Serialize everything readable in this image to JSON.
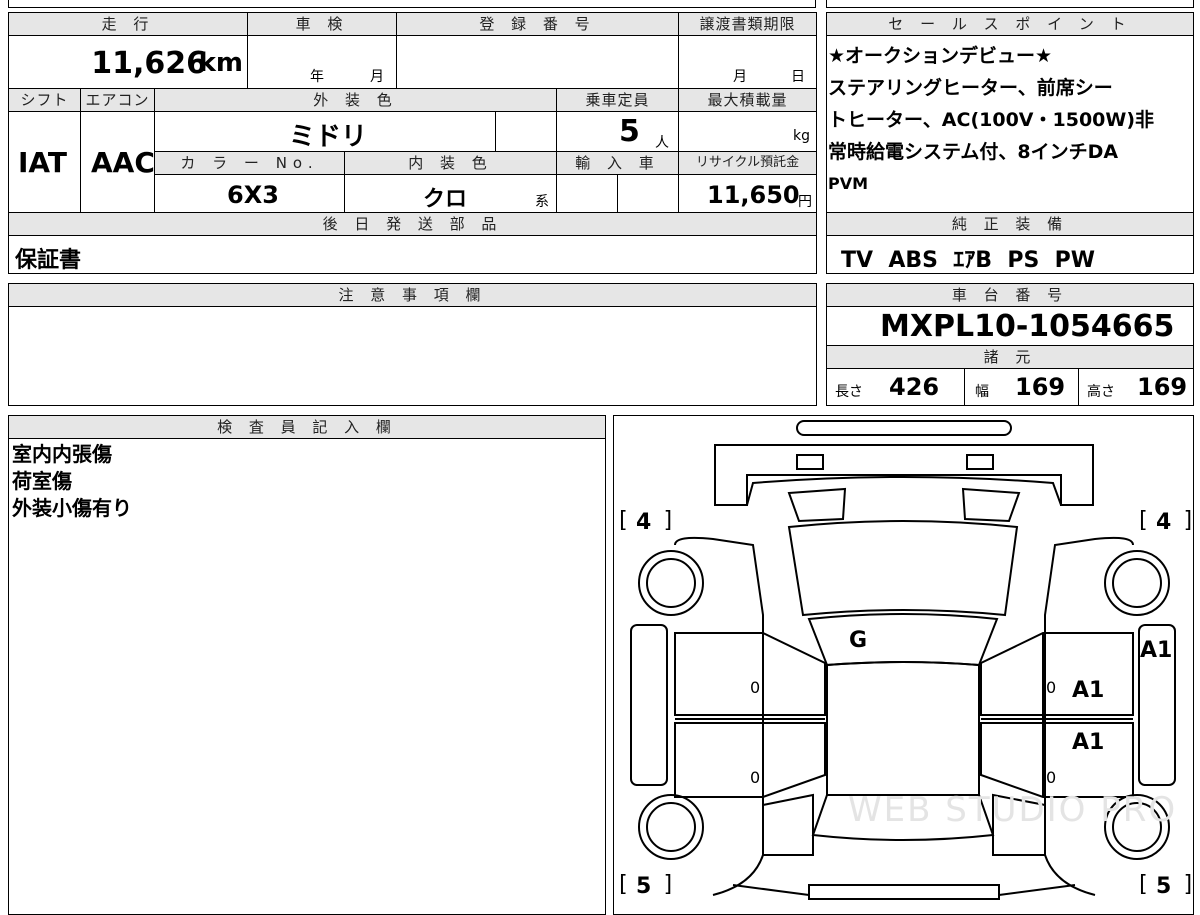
{
  "mileage": {
    "header": "走 行",
    "value": "11,626",
    "unit": "km"
  },
  "inspection": {
    "header": "車 検",
    "year_label": "年",
    "month_label": "月"
  },
  "registration": {
    "header": "登 録 番 号",
    "value": ""
  },
  "transfer_deadline": {
    "header": "譲渡書類期限",
    "month_label": "月",
    "day_label": "日"
  },
  "shift": {
    "header": "シフト",
    "value": "IAT"
  },
  "aircon": {
    "header": "エアコン",
    "value": "AAC"
  },
  "exterior_color": {
    "header": "外 装 色",
    "value": "ミドリ"
  },
  "capacity": {
    "header": "乗車定員",
    "value": "5",
    "unit": "人"
  },
  "max_load": {
    "header": "最大積載量",
    "unit": "kg"
  },
  "color_no": {
    "header": "カ ラ ー No.",
    "value": "6X3"
  },
  "interior_color": {
    "header": "内 装 色",
    "value": "クロ",
    "suffix": "系"
  },
  "import": {
    "header": "輸 入 車"
  },
  "recycle": {
    "header": "リサイクル預託金",
    "value": "11,650",
    "unit": "円"
  },
  "later_parts": {
    "header": "後 日 発 送 部 品",
    "value": "保証書"
  },
  "sales_points": {
    "header": "セ ー ル ス ポ イ ン ト",
    "lines": [
      "★オークションデビュー★",
      "ステアリングヒーター、前席シー",
      "トヒーター、AC(100V・1500W)非",
      "常時給電システム付、8インチDA",
      "PVM"
    ]
  },
  "equipment": {
    "header": "純 正 装 備",
    "value": "TV  ABS  ｴｱB  PS  PW"
  },
  "notes": {
    "header": "注 意 事 項 欄"
  },
  "chassis": {
    "header": "車 台 番 号",
    "value": "MXPL10-1054665"
  },
  "dims": {
    "header": "諸 元",
    "length_label": "長さ",
    "length": "426",
    "width_label": "幅",
    "width": "169",
    "height_label": "高さ",
    "height": "169"
  },
  "inspector": {
    "header": "検 査 員 記 入 欄",
    "lines": [
      "室内内張傷",
      "荷室傷",
      "外装小傷有り"
    ]
  },
  "diagram": {
    "tire_front_left": "4",
    "tire_front_right": "4",
    "tire_rear_left": "5",
    "tire_rear_right": "5",
    "windshield": "G",
    "right_fender": "A1",
    "right_front_door": "A1",
    "right_rear_door": "A1",
    "door_mark_lf": "0",
    "door_mark_lr": "0",
    "door_mark_rf": "0",
    "door_mark_rr": "0",
    "watermark": "WEB STUDIO PRO"
  }
}
